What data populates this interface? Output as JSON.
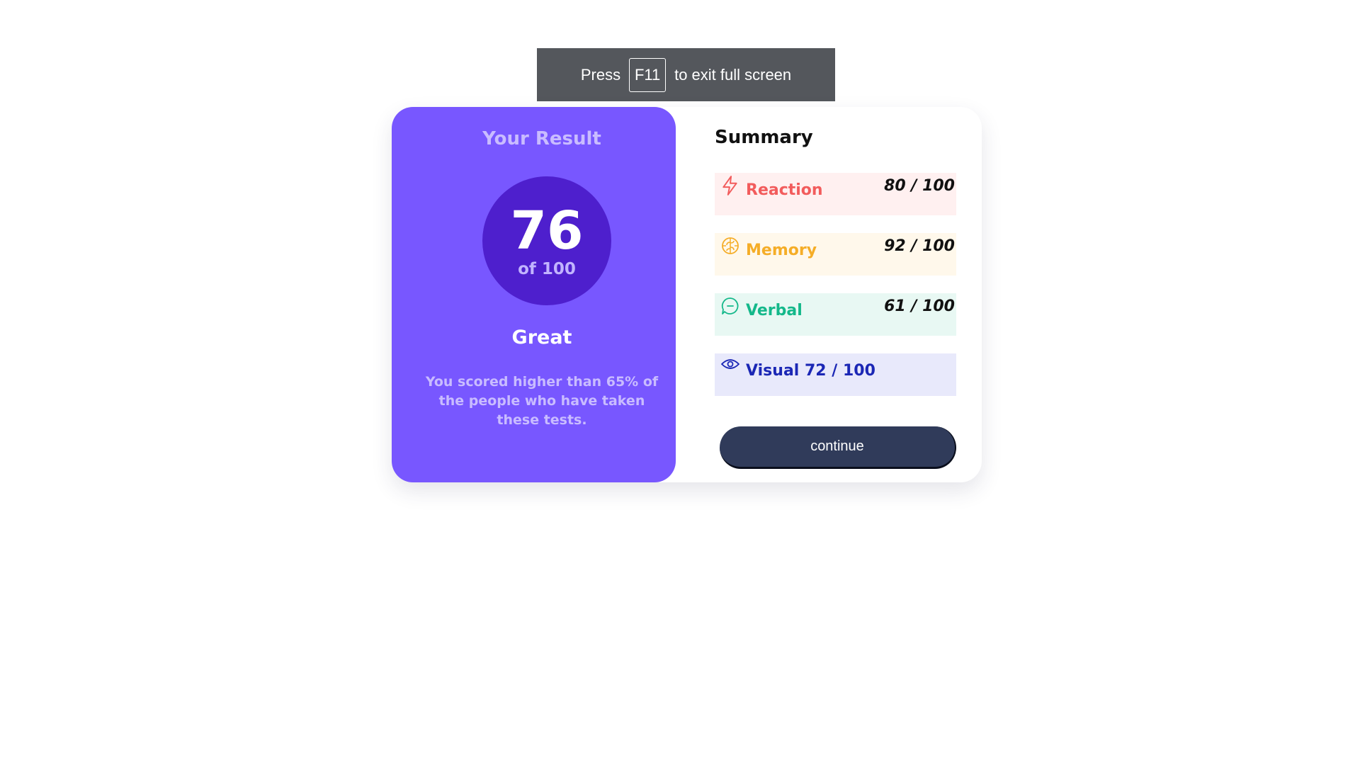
{
  "fullscreen_notice": {
    "prefix": "Press",
    "key": "F11",
    "suffix": "to exit full screen"
  },
  "result": {
    "title": "Your Result",
    "score": "76",
    "out_of": "of 100",
    "rating": "Great",
    "description": "You scored higher than 65% of the people who have taken these tests."
  },
  "summary": {
    "title": "Summary",
    "items": [
      {
        "name": "Reaction",
        "score": "80 / 100",
        "icon": "lightning-icon",
        "color": "#f25c5c",
        "bg": "#fff0f0"
      },
      {
        "name": "Memory",
        "score": "92 / 100",
        "icon": "brain-icon",
        "color": "#f5ad27",
        "bg": "#fff8eb"
      },
      {
        "name": "Verbal",
        "score": "61 / 100",
        "icon": "speech-bubble-icon",
        "color": "#14b88a",
        "bg": "#e8f8f3"
      },
      {
        "name": "Visual",
        "score": "72 / 100",
        "icon": "eye-icon",
        "color": "#1b27b5",
        "bg": "#e8e9fb"
      }
    ]
  },
  "actions": {
    "continue_label": "continue"
  }
}
